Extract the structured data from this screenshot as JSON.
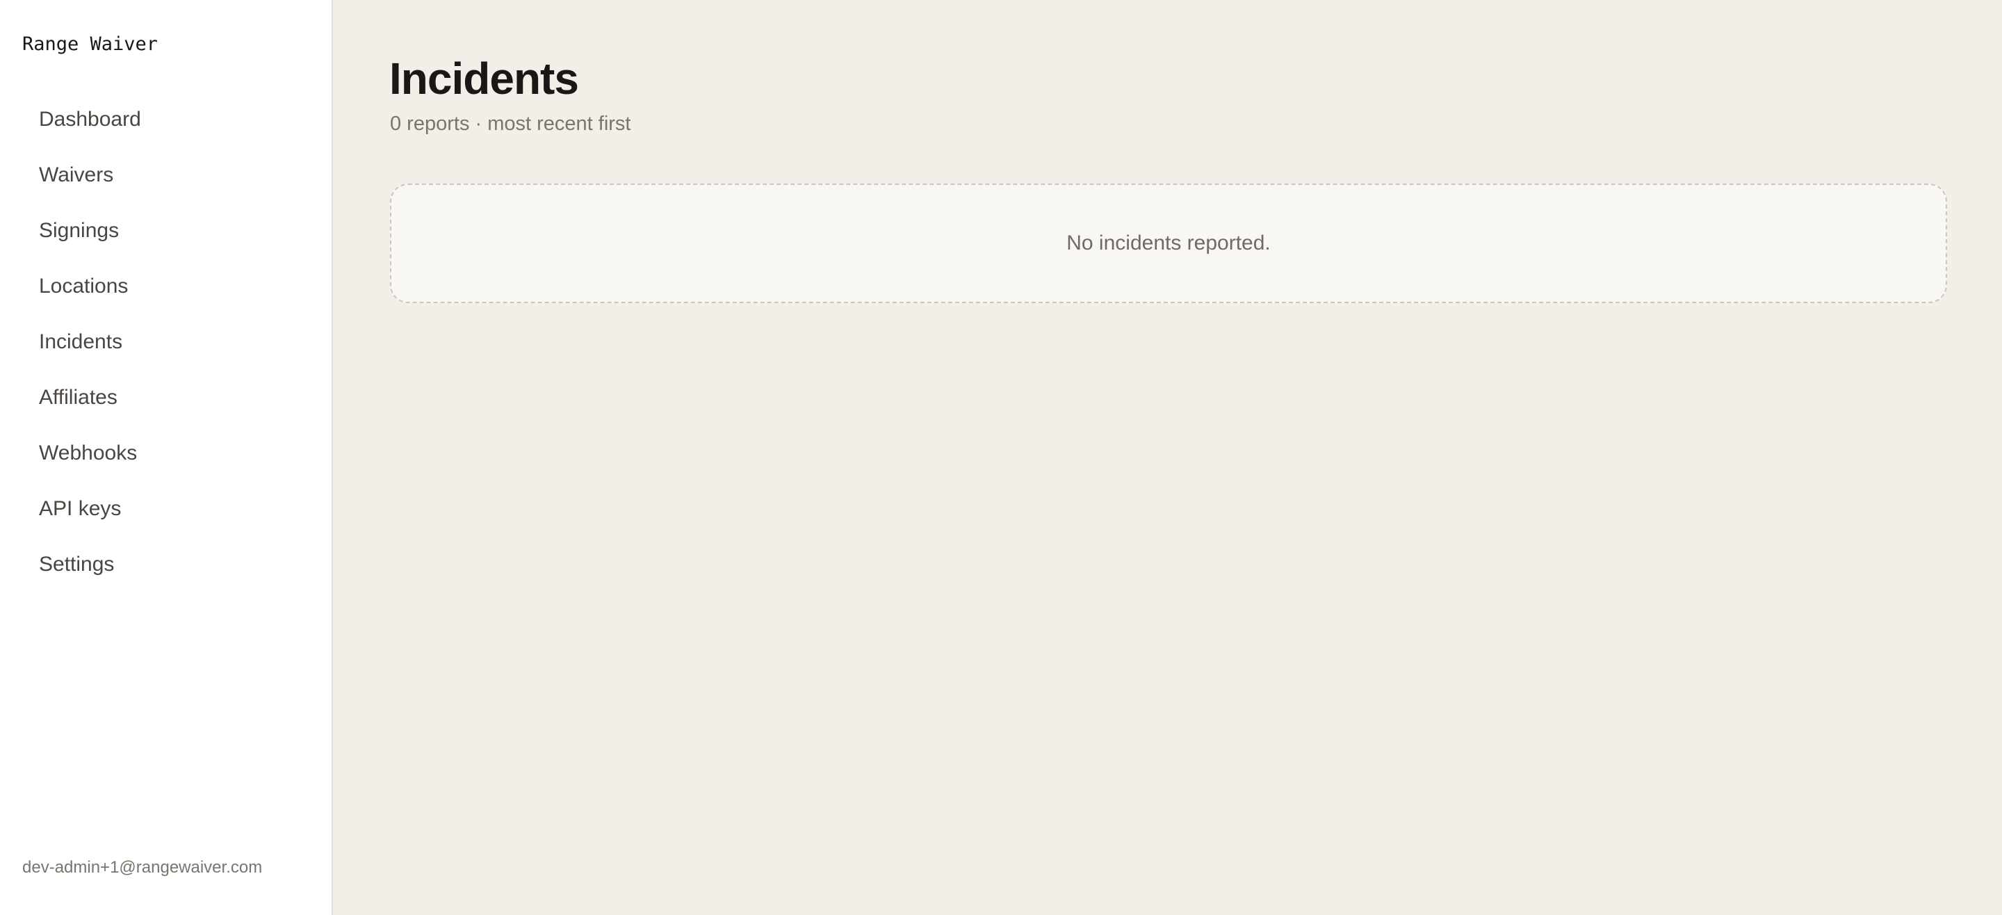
{
  "sidebar": {
    "brand": "Range Waiver",
    "items": [
      {
        "label": "Dashboard"
      },
      {
        "label": "Waivers"
      },
      {
        "label": "Signings"
      },
      {
        "label": "Locations"
      },
      {
        "label": "Incidents"
      },
      {
        "label": "Affiliates"
      },
      {
        "label": "Webhooks"
      },
      {
        "label": "API keys"
      },
      {
        "label": "Settings"
      }
    ],
    "user_email": "dev-admin+1@rangewaiver.com"
  },
  "main": {
    "title": "Incidents",
    "subtitle": "0 reports · most recent first",
    "empty_message": "No incidents reported."
  }
}
